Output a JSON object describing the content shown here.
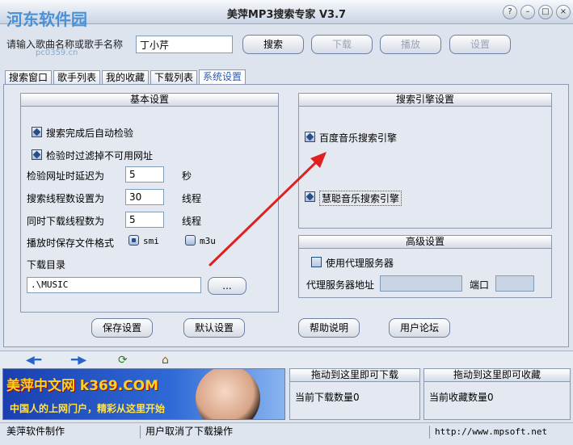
{
  "window": {
    "title": "美萍MP3搜索专家 V3.7",
    "watermark": "河东软件园",
    "watermark_sub": "pc0359.cn"
  },
  "search": {
    "label": "请输入歌曲名称或歌手名称",
    "value": "丁小芹",
    "search_btn": "搜索",
    "download_btn": "下载",
    "play_btn": "播放",
    "settings_btn": "设置"
  },
  "tabs": [
    {
      "label": "搜索窗口"
    },
    {
      "label": "歌手列表"
    },
    {
      "label": "我的收藏"
    },
    {
      "label": "下载列表"
    },
    {
      "label": "系统设置"
    }
  ],
  "basic": {
    "title": "基本设置",
    "auto_check": "搜索完成后自动检验",
    "filter_bad": "检验时过滤掉不可用网址",
    "delay_label": "检验网址时延迟为",
    "delay_value": "5",
    "delay_unit": "秒",
    "threads_label": "搜索线程数设置为",
    "threads_value": "30",
    "threads_unit": "线程",
    "dl_threads_label": "同时下载线程数为",
    "dl_threads_value": "5",
    "dl_threads_unit": "线程",
    "format_label": "播放时保存文件格式",
    "format_smi": "smi",
    "format_m3u": "m3u",
    "dir_label": "下载目录",
    "dir_value": ".\\MUSIC",
    "browse_btn": "..."
  },
  "engine": {
    "title": "搜索引擎设置",
    "baidu": "百度音乐搜索引擎",
    "huicong": "慧聪音乐搜索引擎"
  },
  "advanced": {
    "title": "高级设置",
    "use_proxy": "使用代理服务器",
    "proxy_addr_label": "代理服务器地址",
    "port_label": "端口"
  },
  "actions": {
    "save": "保存设置",
    "default": "默认设置",
    "help": "帮助说明",
    "forum": "用户论坛"
  },
  "banner": {
    "brand": "美萍中文网 k369.COM",
    "slogan": "中国人的上网门户，精彩从这里开始"
  },
  "drop": {
    "download_hdr": "拖动到这里即可下载",
    "download_count": "当前下载数量0",
    "fav_hdr": "拖动到这里即可收藏",
    "fav_count": "当前收藏数量0"
  },
  "status": {
    "maker": "美萍软件制作",
    "message": "用户取消了下载操作",
    "url": "http://www.mpsoft.net"
  },
  "colors": {
    "arrow": "#e02020",
    "accent": "#2a5bbf"
  }
}
